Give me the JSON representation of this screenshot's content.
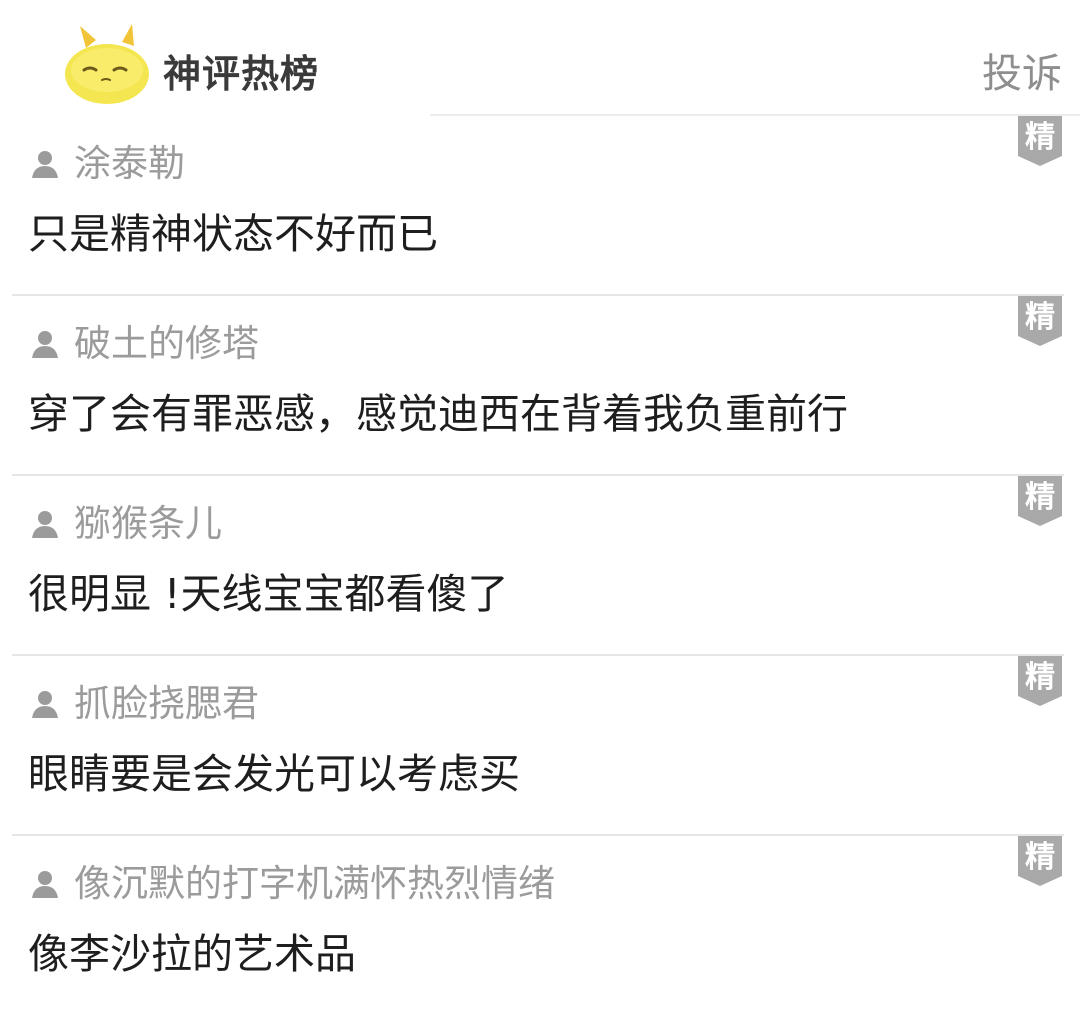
{
  "header": {
    "title": "神评热榜",
    "report_label": "投诉",
    "mascot_icon": "yellow-bunny-mascot-icon"
  },
  "badge_label": "精",
  "colors": {
    "badge": "#a9a9a9",
    "username": "#9b9b9b",
    "comment_text": "#1e1e1e",
    "divider": "#e6e6e6",
    "mascot": "#f2e24a"
  },
  "comments": [
    {
      "username": "涂泰勒",
      "text": "只是精神状态不好而已"
    },
    {
      "username": "破土的修塔",
      "text": "穿了会有罪恶感，感觉迪西在背着我负重前行"
    },
    {
      "username": "猕猴条儿",
      "text": "很明显 !天线宝宝都看傻了"
    },
    {
      "username": "抓脸挠腮君",
      "text": "眼睛要是会发光可以考虑买"
    },
    {
      "username": "像沉默的打字机满怀热烈情绪",
      "text": "像李沙拉的艺术品"
    }
  ]
}
